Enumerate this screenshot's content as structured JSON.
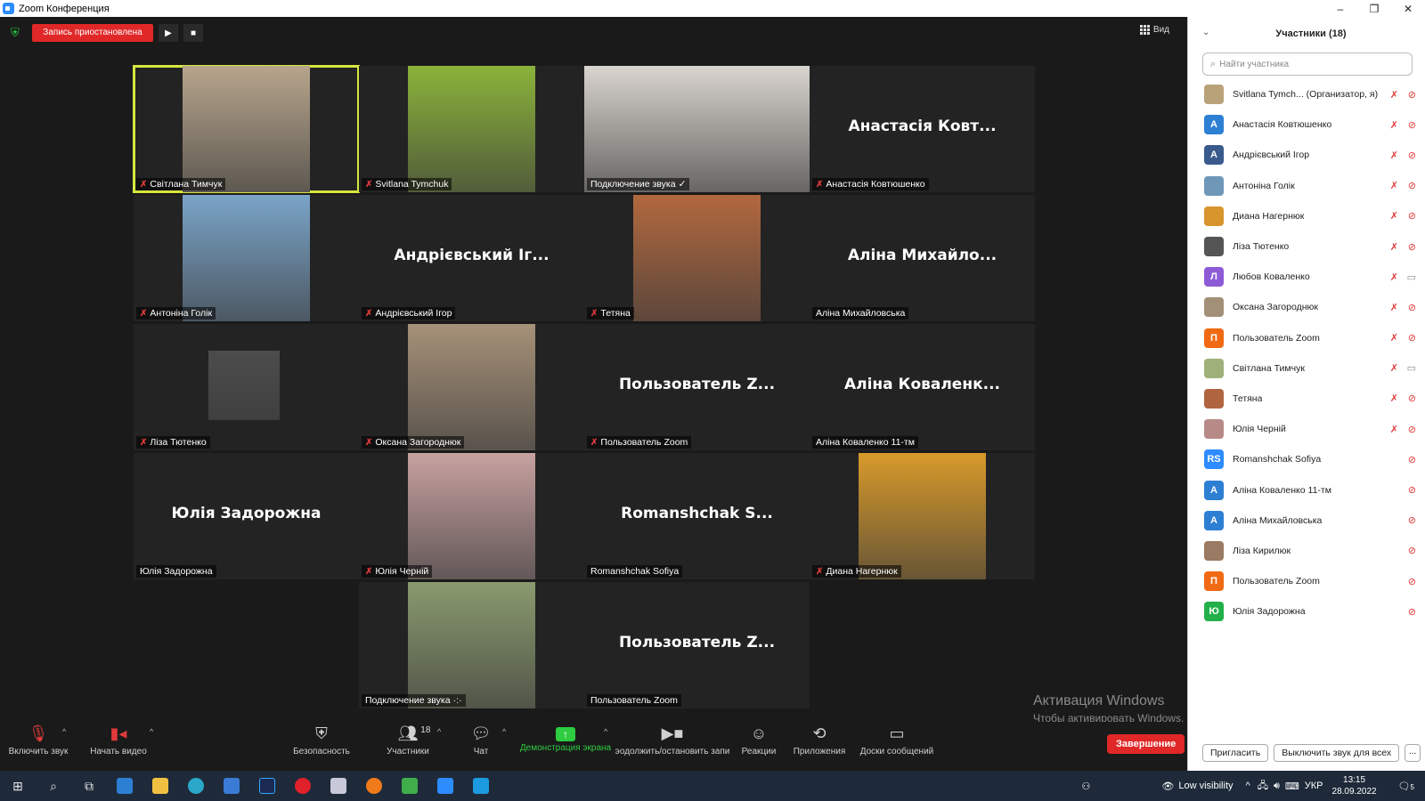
{
  "window": {
    "title": "Zoom Конференция",
    "controls": [
      "–",
      "❐",
      "✕"
    ]
  },
  "recording": {
    "label": "Запись приостановлена"
  },
  "view_button": {
    "label": "Вид"
  },
  "tiles": [
    {
      "name": "Світлана Тимчук",
      "display": "",
      "muted": true,
      "photo": true,
      "photo_color": "#b7a58c",
      "active": true
    },
    {
      "name": "Svitlana Tymchuk",
      "display": "",
      "muted": true,
      "photo": true,
      "photo_color": "#8bb33a"
    },
    {
      "name": "Подключение звука",
      "display": "",
      "muted": false,
      "photo": true,
      "photo_color": "#d9d4ce",
      "wide": true,
      "check": true
    },
    {
      "name": "Анастасія Ковтюшенко",
      "display": "Анастасія Ковт...",
      "muted": true,
      "photo": false
    },
    {
      "name": "Антоніна Голік",
      "display": "",
      "muted": true,
      "photo": true,
      "photo_color": "#7aa4c8"
    },
    {
      "name": "Андрієвський Ігор",
      "display": "Андрієвський Іг...",
      "muted": true,
      "photo": false
    },
    {
      "name": "Тетяна",
      "display": "",
      "muted": true,
      "photo": true,
      "photo_color": "#b2683e"
    },
    {
      "name": "Аліна Михайловська",
      "display": "Аліна Михайло...",
      "muted": false,
      "photo": false
    },
    {
      "name": "Ліза Тютенко",
      "display": "",
      "muted": true,
      "photo": true,
      "photo_color": "#4c4c4c",
      "small": true
    },
    {
      "name": "Оксана Загороднюк",
      "display": "",
      "muted": true,
      "photo": true,
      "photo_color": "#a69178"
    },
    {
      "name": "Пользователь Zoom",
      "display": "Пользователь Z...",
      "muted": true,
      "photo": false
    },
    {
      "name": "Аліна Коваленко 11-тм",
      "display": "Аліна Коваленк...",
      "muted": false,
      "photo": false
    },
    {
      "name": "Юлія Задорожна",
      "display": "Юлія Задорожна",
      "muted": false,
      "photo": false
    },
    {
      "name": "Юлія Черній",
      "display": "",
      "muted": true,
      "photo": true,
      "photo_color": "#c7a1a0"
    },
    {
      "name": "Romanshchak Sofiya",
      "display": "Romanshchak S...",
      "muted": false,
      "photo": false
    },
    {
      "name": "Диана Нагернюк",
      "display": "",
      "muted": true,
      "photo": true,
      "photo_color": "#d89a2a"
    },
    {
      "name": "Подключение звука",
      "display": "",
      "muted": false,
      "photo": true,
      "photo_color": "#8a9a6e",
      "dots": true
    },
    {
      "name": "Пользователь Zoom",
      "display": "Пользователь Z...",
      "muted": false,
      "photo": false
    }
  ],
  "watermark": {
    "line1": "Активация Windows",
    "line2": "Чтобы активировать Windows, перейдите в раздел \"Параметры\"."
  },
  "toolbar": {
    "unmute": "Включить звук",
    "start_video": "Начать видео",
    "security": "Безопасность",
    "participants": "Участники",
    "participants_count": "18",
    "chat": "Чат",
    "share": "Демонстрация экрана",
    "record": "эодолжить/остановить запи",
    "reactions": "Реакции",
    "apps": "Приложения",
    "whiteboards": "Доски сообщений",
    "end": "Завершение"
  },
  "panel": {
    "title": "Участники (18)",
    "search_placeholder": "Найти участника",
    "participants": [
      {
        "name": "Svitlana Tymch... (Организатор, я)",
        "initial": "",
        "color": "#b9a27a",
        "mic": true,
        "video_off": true
      },
      {
        "name": "Анастасія Ковтюшенко",
        "initial": "А",
        "color": "#2d7fd3",
        "mic": true,
        "video_off": true
      },
      {
        "name": "Андрієвський Ігор",
        "initial": "А",
        "color": "#3a5a8c",
        "mic": true,
        "video_off": true
      },
      {
        "name": "Антоніна Голік",
        "initial": "",
        "color": "#6f97b8",
        "mic": true,
        "video_off": true
      },
      {
        "name": "Диана Нагернюк",
        "initial": "",
        "color": "#d8952d",
        "mic": true,
        "video_off": true
      },
      {
        "name": "Ліза Тютенко",
        "initial": "",
        "color": "#555555",
        "mic": true,
        "video_off": true
      },
      {
        "name": "Любов Коваленко",
        "initial": "Л",
        "color": "#8e5bd6",
        "mic": true,
        "video_off": false
      },
      {
        "name": "Оксана Загороднюк",
        "initial": "",
        "color": "#a39078",
        "mic": true,
        "video_off": true
      },
      {
        "name": "Пользователь Zoom",
        "initial": "П",
        "color": "#f06a14",
        "mic": true,
        "video_off": true
      },
      {
        "name": "Світлана Тимчук",
        "initial": "",
        "color": "#9fb17a",
        "mic": true,
        "video_off": false
      },
      {
        "name": "Тетяна",
        "initial": "",
        "color": "#b06540",
        "mic": true,
        "video_off": true
      },
      {
        "name": "Юлія Черній",
        "initial": "",
        "color": "#b78a88",
        "mic": true,
        "video_off": true
      },
      {
        "name": "Romanshchak Sofiya",
        "initial": "RS",
        "color": "#2d8cff",
        "mic": false,
        "video_off": true
      },
      {
        "name": "Аліна Коваленко 11-тм",
        "initial": "А",
        "color": "#2d7fd3",
        "mic": false,
        "video_off": true
      },
      {
        "name": "Аліна Михайловська",
        "initial": "А",
        "color": "#2d7fd3",
        "mic": false,
        "video_off": true
      },
      {
        "name": "Ліза Кирилюк",
        "initial": "",
        "color": "#9a7a62",
        "mic": false,
        "video_off": true
      },
      {
        "name": "Пользователь Zoom",
        "initial": "П",
        "color": "#f06a14",
        "mic": false,
        "video_off": true
      },
      {
        "name": "Юлія Задорожна",
        "initial": "Ю",
        "color": "#22b04a",
        "mic": false,
        "video_off": true
      }
    ],
    "invite": "Пригласить",
    "mute_all": "Выключить звук для всех",
    "more": "..."
  },
  "taskbar": {
    "low_visibility": "Low visibility",
    "lang": "УКР",
    "time": "13:15",
    "date": "28.09.2022",
    "notifications": "5"
  }
}
